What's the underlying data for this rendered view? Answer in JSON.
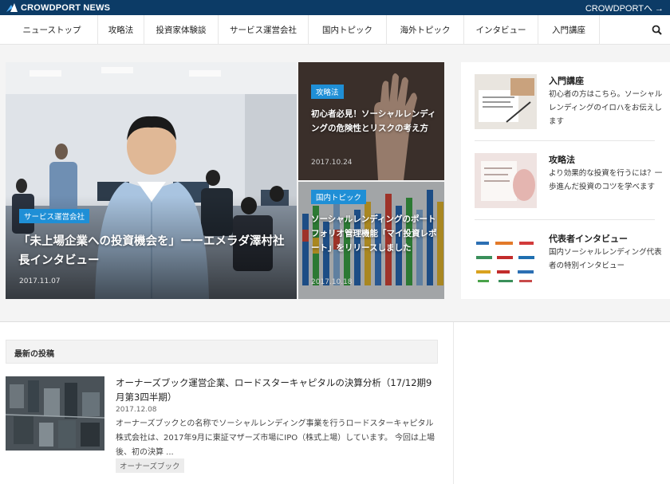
{
  "topbar": {
    "brand": "CROWDPORT NEWS",
    "link": "CROWDPORTへ →"
  },
  "nav": {
    "items": [
      "ニューストップ",
      "攻略法",
      "投資家体験談",
      "サービス運営会社",
      "国内トピック",
      "海外トピック",
      "インタビュー",
      "入門講座"
    ],
    "search_icon": "search-icon"
  },
  "hero": {
    "category": "サービス運営会社",
    "title": "「未上場企業への投資機会を」ーーエメラダ澤村社長インタビュー",
    "date": "2017.11.07"
  },
  "cards": [
    {
      "category": "攻略法",
      "title": "初心者必見！ソーシャルレンディングの危険性とリスクの考え方",
      "date": "2017.10.24"
    },
    {
      "category": "国内トピック",
      "title": "ソーシャルレンディングのポートフォリオ管理機能「マイ投資レポート」をリリースしました",
      "date": "2017.10.18"
    }
  ],
  "sidebar": {
    "items": [
      {
        "title": "入門講座",
        "desc": "初心者の方はこちら。ソーシャルレンディングのイロハをお伝えします"
      },
      {
        "title": "攻略法",
        "desc": "より効果的な投資を行うには？一歩進んだ投資のコツを学べます"
      },
      {
        "title": "代表者インタビュー",
        "desc": "国内ソーシャルレンディング代表者の特別インタビュー"
      }
    ]
  },
  "latest": {
    "heading": "最新の投稿",
    "posts": [
      {
        "title": "オーナーズブック運営企業、ロードスターキャピタルの決算分析（17/12期9月第3四半期）",
        "date": "2017.12.08",
        "excerpt": "オーナーズブックとの名称でソーシャルレンディング事業を行うロードスターキャピタル株式会社は、2017年9月に東証マザーズ市場にIPO（株式上場）しています。 今回は上場後、初の決算 ...",
        "tag": "オーナーズブック"
      }
    ]
  },
  "colors": {
    "topbar": "#0c3b66",
    "badge": "#1f8fd6"
  }
}
